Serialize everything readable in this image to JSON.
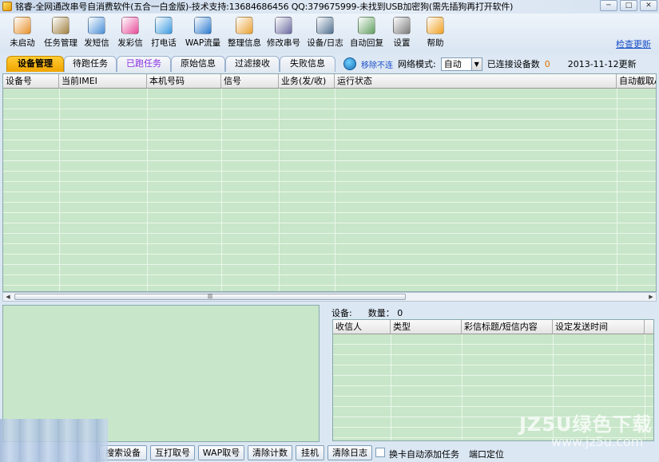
{
  "window": {
    "title": "铭睿-全网通改串号自消费软件(五合一白金版)-技术支持:13684686456 QQ:379675999-未找到USB加密狗(需先插狗再打开软件)",
    "minimize": "─",
    "maximize": "□",
    "close": "✕"
  },
  "toolbar": {
    "items": [
      {
        "label": "未启动",
        "icon": "start-icon",
        "color": "#e8902a"
      },
      {
        "label": "任务管理",
        "icon": "task-manager-icon",
        "color": "#a08040"
      },
      {
        "label": "发短信",
        "icon": "sms-icon",
        "color": "#4a8fd8"
      },
      {
        "label": "发彩信",
        "icon": "mms-icon",
        "color": "#e84a9a"
      },
      {
        "label": "打电话",
        "icon": "phone-call-icon",
        "color": "#3a9ae0"
      },
      {
        "label": "WAP流量",
        "icon": "wap-browser-icon",
        "color": "#2a7ad0"
      },
      {
        "label": "整理信息",
        "icon": "organize-icon",
        "color": "#e8a030"
      },
      {
        "label": "修改串号",
        "icon": "modify-imei-icon",
        "color": "#6a6aa0"
      },
      {
        "label": "设备/日志",
        "icon": "device-log-icon",
        "color": "#507090"
      },
      {
        "label": "自动回复",
        "icon": "auto-reply-icon",
        "color": "#60a060"
      },
      {
        "label": "设置",
        "icon": "settings-icon",
        "color": "#7a7a7a"
      },
      {
        "label": "帮助",
        "icon": "help-icon",
        "color": "#f0a020"
      }
    ],
    "check_update": "检查更新"
  },
  "tabs": [
    {
      "label": "设备管理"
    },
    {
      "label": "待跑任务"
    },
    {
      "label": "已跑任务"
    },
    {
      "label": "原始信息"
    },
    {
      "label": "过滤接收"
    },
    {
      "label": "失败信息"
    }
  ],
  "status": {
    "remove_label": "移除不连",
    "network_mode_label": "网络模式:",
    "network_mode_value": "自动",
    "connected_label": "已连接设备数",
    "connected_count": "0",
    "update_date": "2013-11-12更新"
  },
  "device_grid": {
    "columns": [
      "设备号",
      "当前IMEI",
      "本机号码",
      "信号",
      "业务(发/收)",
      "运行状态",
      "自动截取A"
    ]
  },
  "right_panel": {
    "device_label": "设备:",
    "count_label": "数量：",
    "count_value": "0",
    "columns": [
      "收信人",
      "类型",
      "彩信标题/短信内容",
      "设定发送时间"
    ]
  },
  "bottom": {
    "buttons": [
      "搜索设备",
      "互打取号",
      "WAP取号",
      "清除计数",
      "挂机",
      "清除日志"
    ],
    "checkbox_label": "换卡自动添加任务",
    "port_label": "端口定位"
  },
  "watermark": {
    "line1": "JZ5U绿色下载",
    "line2": "www.jz5u.com"
  }
}
